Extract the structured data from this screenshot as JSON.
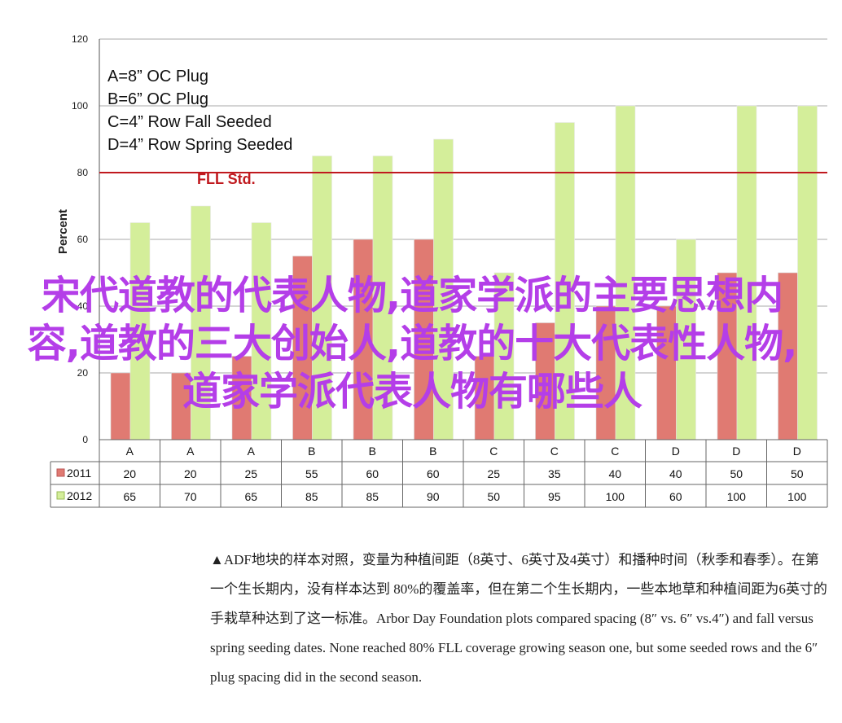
{
  "chart_data": {
    "type": "bar",
    "categories": [
      "A",
      "A",
      "A",
      "B",
      "B",
      "B",
      "C",
      "C",
      "C",
      "D",
      "D",
      "D"
    ],
    "series": [
      {
        "name": "2011",
        "values": [
          20,
          20,
          25,
          55,
          60,
          60,
          25,
          35,
          40,
          40,
          50,
          50
        ],
        "color": "#e07a72"
      },
      {
        "name": "2012",
        "values": [
          65,
          70,
          65,
          85,
          85,
          90,
          50,
          95,
          100,
          60,
          100,
          100
        ],
        "color": "#d4ee9a"
      }
    ],
    "ylabel": "Percent",
    "ylim": [
      0,
      120
    ],
    "yticks": [
      "0",
      "20",
      "40",
      "60",
      "80",
      "100",
      "120"
    ],
    "grid": true,
    "reference_line": {
      "value": 80,
      "label": "FLL Std.",
      "color": "#c0191e"
    },
    "legend_notes": [
      "A=8” OC Plug",
      "B=6” OC Plug",
      "C=4” Row Fall Seeded",
      "D=4” Row Spring Seeded"
    ],
    "table": true
  },
  "overlay_title": "宋代道教的代表人物,道家学派的主要思想内容,道教的三大创始人,道教的十大代表性人物,道家学派代表人物有哪些人",
  "caption": "▲ADF地块的样本对照，变量为种植间距（8英寸、6英寸及4英寸）和播种时间（秋季和春季）。在第一个生长期内，没有样本达到 80%的覆盖率，但在第二个生长期内，一些本地草和种植间距为6英寸的手栽草种达到了这一标准。Arbor Day Foundation plots compared spacing (8″ vs. 6″ vs.4″) and fall versus spring seeding dates. None reached 80% FLL coverage growing season one, but some seeded rows and the 6″ plug spacing did in the second season."
}
